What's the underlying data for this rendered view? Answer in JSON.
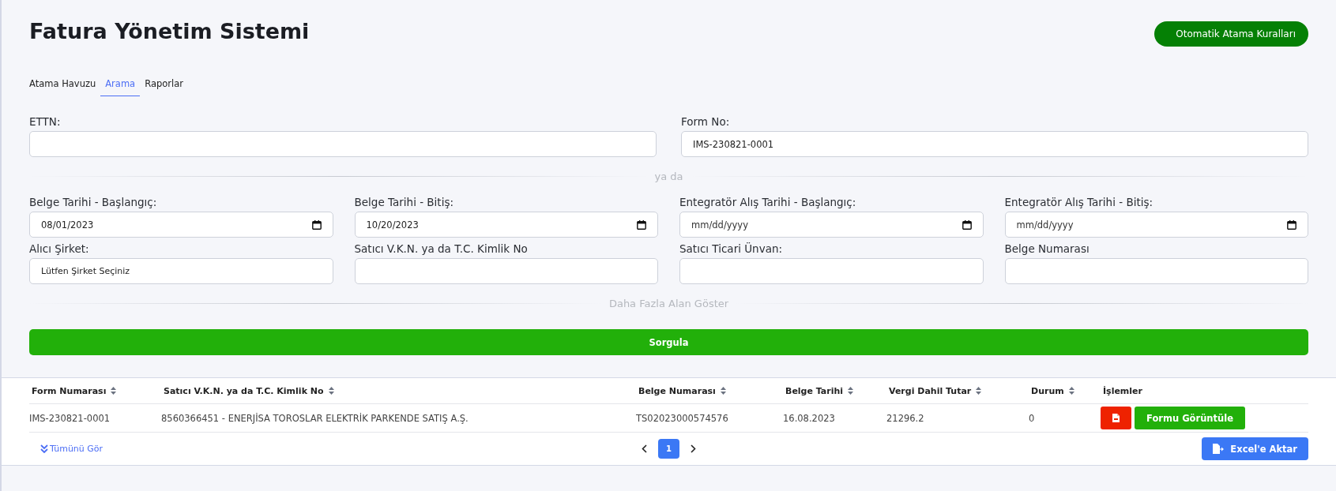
{
  "title": "Fatura Yönetim Sistemi",
  "rules_button": "Otomatik Atama Kuralları",
  "tabs": [
    {
      "label": "Atama Havuzu",
      "selected": false
    },
    {
      "label": "Arama",
      "selected": true
    },
    {
      "label": "Raporlar",
      "selected": false
    }
  ],
  "top_fields": [
    {
      "label": "ETTN:",
      "kind": "text"
    },
    {
      "label": "Form No:",
      "kind": "text",
      "value": "IMS-230821-0001"
    }
  ],
  "divider_1": "ya da",
  "fields": [
    {
      "label": "Belge Tarihi - Başlangıç:",
      "kind": "date",
      "value": "08/01/2023"
    },
    {
      "label": "Belge Tarihi - Bitiş:",
      "kind": "date",
      "value": "10/20/2023"
    },
    {
      "label": "Entegratör Alış Tarihi - Başlangıç:",
      "kind": "date",
      "placeholder": "mm/dd/yyyy"
    },
    {
      "label": "Entegratör Alış Tarihi - Bitiş:",
      "kind": "date",
      "placeholder": "mm/dd/yyyy"
    },
    {
      "label": "Alıcı Şirket:",
      "kind": "select",
      "value": "Lütfen Şirket Seçiniz"
    },
    {
      "label": "Satıcı V.K.N. ya da T.C. Kimlik No",
      "kind": "text"
    },
    {
      "label": "Satıcı Ticari Ünvan:",
      "kind": "text"
    },
    {
      "label": "Belge Numarası",
      "kind": "text"
    }
  ],
  "divider_2": "Daha Fazla Alan Göster",
  "query_button": "Sorgula",
  "table": {
    "columns": [
      {
        "label": "Form Numarası",
        "sortable": true
      },
      {
        "label": "Satıcı V.K.N. ya da T.C. Kimlik No",
        "sortable": true
      },
      {
        "label": "Belge Numarası",
        "sortable": true
      },
      {
        "label": "Belge Tarihi",
        "sortable": true
      },
      {
        "label": "Vergi Dahil Tutar",
        "sortable": true
      },
      {
        "label": "Durum",
        "sortable": true
      },
      {
        "label": "İşlemler",
        "sortable": false
      }
    ],
    "rows": [
      {
        "cells": [
          "IMS-230821-0001",
          "8560366451 - ENERJİSA TOROSLAR ELEKTRİK PARKENDE SATIŞ A.Ş.",
          "TS02023000574576",
          "16.08.2023",
          "21296.2",
          "0"
        ],
        "action": "Formu Görüntüle"
      }
    ]
  },
  "show_all": "Tümünü Gör",
  "pages": [
    {
      "label": "1",
      "selected": true
    }
  ],
  "export_button": "Excel'e Aktar"
}
